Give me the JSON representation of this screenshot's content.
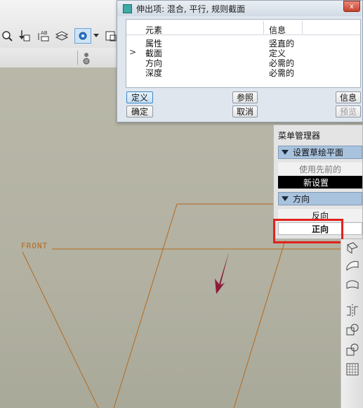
{
  "dialog": {
    "title": "伸出项: 混合, 平行, 规则截面",
    "close_label": "x",
    "columns": {
      "element": "元素",
      "info": "信息"
    },
    "rows": [
      {
        "element": "属性",
        "info": "竖直的"
      },
      {
        "element": "截面",
        "info": "定义",
        "current": true
      },
      {
        "element": "方向",
        "info": "必需的"
      },
      {
        "element": "深度",
        "info": "必需的"
      }
    ],
    "current_marker": ">",
    "buttons": {
      "define": "定义",
      "reference": "参照",
      "info": "信息",
      "ok": "确定",
      "cancel": "取消",
      "preview": "预览"
    }
  },
  "menu_manager": {
    "title": "菜单管理器",
    "sections": [
      {
        "label": "设置草绘平面",
        "items": [
          "使用先前的",
          "新设置"
        ]
      },
      {
        "label": "方向",
        "items": [
          "反向",
          "正向"
        ]
      }
    ]
  },
  "canvas": {
    "plane_label": "FRONT",
    "line_color": "#b56a1e",
    "arrow_color": "#8e1b3b"
  },
  "toolbar": {
    "icons": [
      "zoom-icon",
      "insert-arrow-icon",
      "ab-annotation-icon",
      "layers-icon",
      "view-display-icon",
      "dropdown-chevron-icon",
      "frame-icon"
    ]
  },
  "colors": {
    "highlight": "#e0221d",
    "menu_header": "#a9c3de",
    "selected_item_bg": "#000000"
  }
}
